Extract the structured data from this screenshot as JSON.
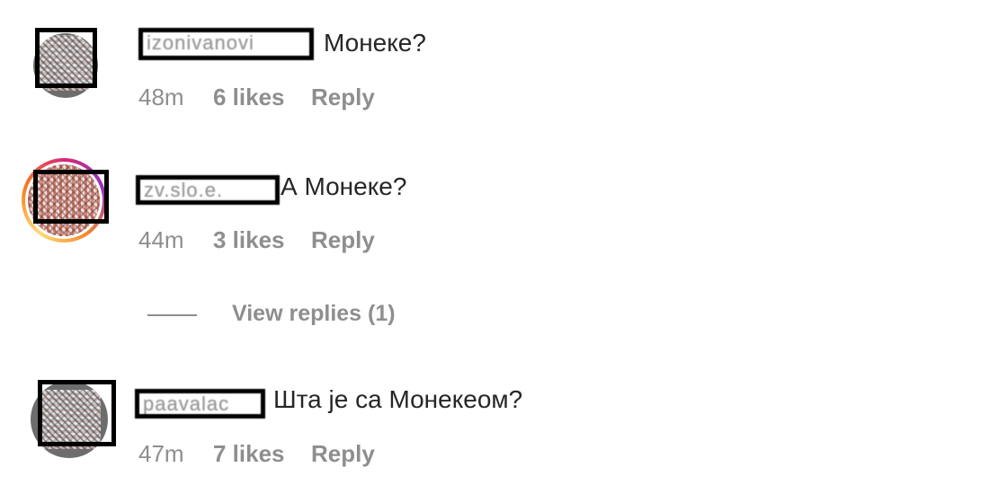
{
  "comments": [
    {
      "username": "izonivanovi",
      "text": "Монеке?",
      "time": "48m",
      "likes": "6 likes",
      "reply": "Reply"
    },
    {
      "username": "zv.slo.e.",
      "text": "А Монеке?",
      "time": "44m",
      "likes": "3 likes",
      "reply": "Reply"
    },
    {
      "username": "paavalac",
      "text": "Шта је са Монекеом?",
      "time": "47m",
      "likes": "7 likes",
      "reply": "Reply"
    }
  ],
  "view_replies": "View replies (1)",
  "colors": {
    "text": "#262626",
    "meta": "#8e8e8e",
    "redaction": "#000000"
  }
}
